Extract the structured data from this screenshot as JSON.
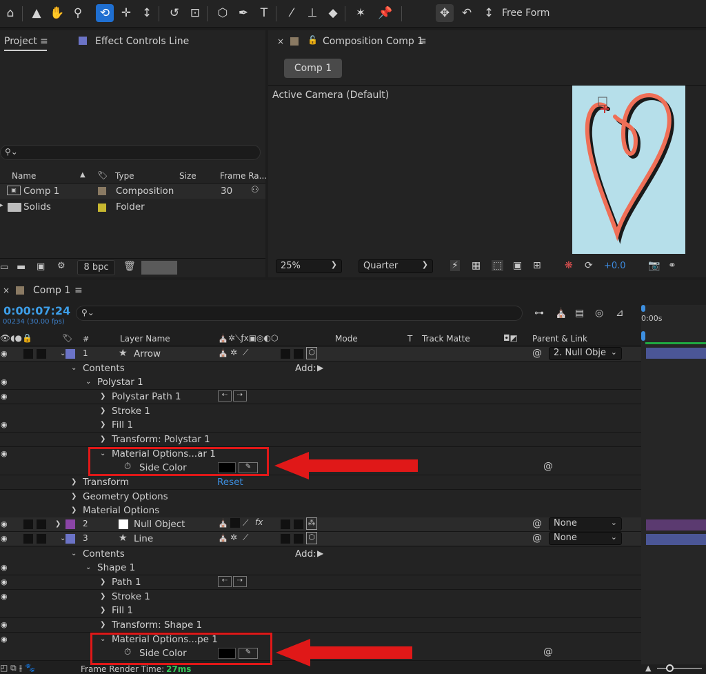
{
  "toolbar": {
    "workspace_label": "Free Form",
    "icons": [
      "home-icon",
      "selection-arrow-icon",
      "hand-icon",
      "zoom-icon",
      "orbit-camera-icon",
      "pan-camera-icon",
      "dolly-camera-icon",
      "rotate-icon",
      "pan-behind-icon",
      "shape-icon",
      "pen-icon",
      "text-icon",
      "brush-icon",
      "clone-stamp-icon",
      "eraser-icon",
      "roto-brush-icon",
      "puppet-pin-icon",
      "universal-gizmo-icon",
      "rotation-gizmo-icon",
      "scale-gizmo-icon"
    ]
  },
  "project_panel": {
    "tab_project": "Project",
    "tab_effect_controls": "Effect Controls Line",
    "columns": {
      "name": "Name",
      "type": "Type",
      "size": "Size",
      "frame_rate": "Frame Ra..."
    },
    "items": [
      {
        "name": "Comp 1",
        "type": "Composition",
        "frame_rate": "30",
        "label_color": "#8a7a63"
      },
      {
        "name": "Solids",
        "type": "Folder",
        "frame_rate": "",
        "label_color": "#c8b830"
      }
    ],
    "bpc": "8 bpc"
  },
  "composition_panel": {
    "tab_title": "Composition Comp 1",
    "comp_button": "Comp 1",
    "camera_label": "Active Camera (Default)",
    "zoom": "25%",
    "resolution": "Quarter",
    "exposure": "+0.0",
    "canvas_bg": "#b6dfea",
    "stroke_color": "#ef6f57"
  },
  "timeline": {
    "tab_title": "Comp 1",
    "timecode": "0:00:07:24",
    "frame_info": "00234 (30.00 fps)",
    "ruler_label": "0:00s",
    "columns": {
      "layer_name": "Layer Name",
      "mode": "Mode",
      "t": "T",
      "track_matte": "Track Matte",
      "parent_link": "Parent & Link"
    },
    "add_label": "Add:",
    "reset_label": "Reset",
    "rows": [
      {
        "kind": "layer",
        "num": "1",
        "name": "Arrow",
        "parent": "2. Null Obje",
        "color": "#6b73c6"
      },
      {
        "kind": "prop",
        "name": "Contents"
      },
      {
        "kind": "prop",
        "name": "Polystar 1"
      },
      {
        "kind": "prop",
        "name": "Polystar Path 1"
      },
      {
        "kind": "prop",
        "name": "Stroke 1"
      },
      {
        "kind": "prop",
        "name": "Fill 1"
      },
      {
        "kind": "prop",
        "name": "Transform: Polystar 1"
      },
      {
        "kind": "prop",
        "name": "Material Options...ar 1"
      },
      {
        "kind": "prop",
        "name": "Side Color"
      },
      {
        "kind": "prop",
        "name": "Transform"
      },
      {
        "kind": "prop",
        "name": "Geometry Options"
      },
      {
        "kind": "prop",
        "name": "Material Options"
      },
      {
        "kind": "layer",
        "num": "2",
        "name": "Null Object",
        "parent": "None",
        "color": "#8b45a6"
      },
      {
        "kind": "layer",
        "num": "3",
        "name": "Line",
        "parent": "None",
        "color": "#6b73c6"
      },
      {
        "kind": "prop",
        "name": "Contents"
      },
      {
        "kind": "prop",
        "name": "Shape 1"
      },
      {
        "kind": "prop",
        "name": "Path 1"
      },
      {
        "kind": "prop",
        "name": "Stroke 1"
      },
      {
        "kind": "prop",
        "name": "Fill 1"
      },
      {
        "kind": "prop",
        "name": "Transform: Shape 1"
      },
      {
        "kind": "prop",
        "name": "Material Options...pe 1"
      },
      {
        "kind": "prop",
        "name": "Side Color"
      }
    ],
    "frame_render_label": "Frame Render Time:",
    "frame_render_value": "27ms"
  }
}
